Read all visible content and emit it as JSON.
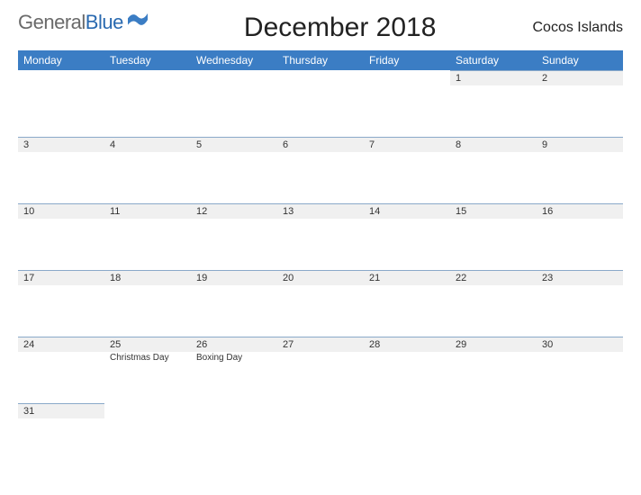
{
  "logo": {
    "part1": "General",
    "part2": "Blue"
  },
  "title": "December 2018",
  "region": "Cocos Islands",
  "dayNames": [
    "Monday",
    "Tuesday",
    "Wednesday",
    "Thursday",
    "Friday",
    "Saturday",
    "Sunday"
  ],
  "weeks": [
    [
      {
        "num": "",
        "event": ""
      },
      {
        "num": "",
        "event": ""
      },
      {
        "num": "",
        "event": ""
      },
      {
        "num": "",
        "event": ""
      },
      {
        "num": "",
        "event": ""
      },
      {
        "num": "1",
        "event": ""
      },
      {
        "num": "2",
        "event": ""
      }
    ],
    [
      {
        "num": "3",
        "event": ""
      },
      {
        "num": "4",
        "event": ""
      },
      {
        "num": "5",
        "event": ""
      },
      {
        "num": "6",
        "event": ""
      },
      {
        "num": "7",
        "event": ""
      },
      {
        "num": "8",
        "event": ""
      },
      {
        "num": "9",
        "event": ""
      }
    ],
    [
      {
        "num": "10",
        "event": ""
      },
      {
        "num": "11",
        "event": ""
      },
      {
        "num": "12",
        "event": ""
      },
      {
        "num": "13",
        "event": ""
      },
      {
        "num": "14",
        "event": ""
      },
      {
        "num": "15",
        "event": ""
      },
      {
        "num": "16",
        "event": ""
      }
    ],
    [
      {
        "num": "17",
        "event": ""
      },
      {
        "num": "18",
        "event": ""
      },
      {
        "num": "19",
        "event": ""
      },
      {
        "num": "20",
        "event": ""
      },
      {
        "num": "21",
        "event": ""
      },
      {
        "num": "22",
        "event": ""
      },
      {
        "num": "23",
        "event": ""
      }
    ],
    [
      {
        "num": "24",
        "event": ""
      },
      {
        "num": "25",
        "event": "Christmas Day"
      },
      {
        "num": "26",
        "event": "Boxing Day"
      },
      {
        "num": "27",
        "event": ""
      },
      {
        "num": "28",
        "event": ""
      },
      {
        "num": "29",
        "event": ""
      },
      {
        "num": "30",
        "event": ""
      }
    ],
    [
      {
        "num": "31",
        "event": ""
      },
      {
        "num": "",
        "event": ""
      },
      {
        "num": "",
        "event": ""
      },
      {
        "num": "",
        "event": ""
      },
      {
        "num": "",
        "event": ""
      },
      {
        "num": "",
        "event": ""
      },
      {
        "num": "",
        "event": ""
      }
    ]
  ]
}
